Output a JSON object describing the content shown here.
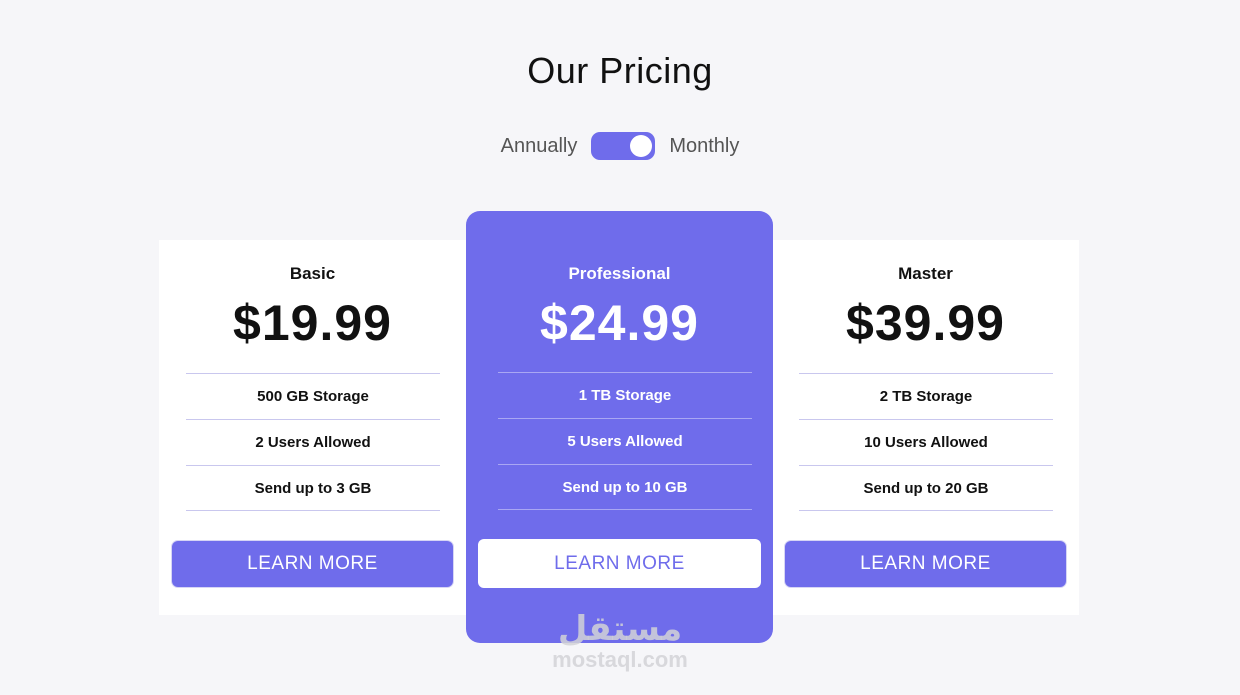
{
  "header": {
    "title": "Our Pricing"
  },
  "billing_toggle": {
    "left_label": "Annually",
    "right_label": "Monthly",
    "state": "monthly"
  },
  "plans": [
    {
      "name": "Basic",
      "price": "$19.99",
      "features": [
        "500 GB Storage",
        "2 Users Allowed",
        "Send up to 3 GB"
      ],
      "button_label": "LEARN MORE"
    },
    {
      "name": "Professional",
      "price": "$24.99",
      "features": [
        "1 TB Storage",
        "5 Users Allowed",
        "Send up to 10 GB"
      ],
      "button_label": "LEARN MORE"
    },
    {
      "name": "Master",
      "price": "$39.99",
      "features": [
        "2 TB Storage",
        "10 Users Allowed",
        "Send up to 20 GB"
      ],
      "button_label": "LEARN MORE"
    }
  ],
  "watermark": {
    "logo_text": "مستقل",
    "domain": "mostaql.com"
  },
  "colors": {
    "accent": "#6f6ceb",
    "background": "#f6f6f9",
    "card": "#ffffff",
    "divider": "#c9c7ee"
  }
}
